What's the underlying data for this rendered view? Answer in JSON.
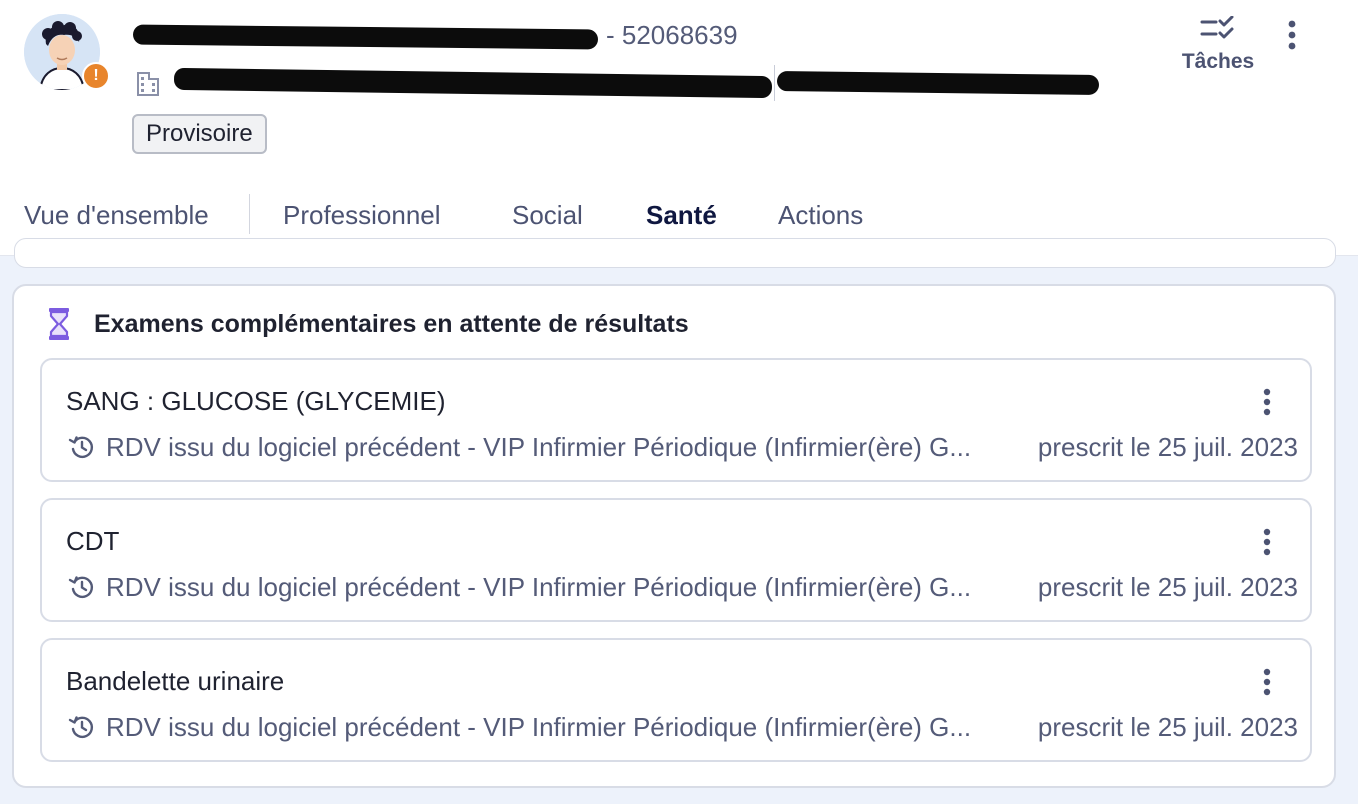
{
  "patient": {
    "id_suffix": "- 52068639",
    "status_badge": "Provisoire",
    "avatar_icon": "avatar-icon",
    "alert_icon": "alert-icon",
    "alert_symbol": "!",
    "alert_color": "#e8852c"
  },
  "company": {
    "icon": "building-icon"
  },
  "header_actions": {
    "tasks_label": "Tâches",
    "tasks_icon": "tasks-checklist-icon",
    "more_icon": "more-vertical-icon"
  },
  "tabs": [
    {
      "label": "Vue d'ensemble",
      "active": false
    },
    {
      "label": "Professionnel",
      "active": false
    },
    {
      "label": "Social",
      "active": false
    },
    {
      "label": "Santé",
      "active": true
    },
    {
      "label": "Actions",
      "active": false
    }
  ],
  "pending_exams": {
    "title": "Examens complémentaires en attente de résultats",
    "title_icon": "hourglass-icon",
    "items": [
      {
        "name": "SANG : GLUCOSE (GLYCEMIE)",
        "origin": "RDV issu du logiciel précédent - VIP Infirmier Périodique (Infirmier(ère) G...",
        "prescribed": "prescrit le 25 juil. 2023"
      },
      {
        "name": "CDT",
        "origin": "RDV issu du logiciel précédent - VIP Infirmier Périodique (Infirmier(ère) G...",
        "prescribed": "prescrit le 25 juil. 2023"
      },
      {
        "name": "Bandelette urinaire",
        "origin": "RDV issu du logiciel précédent - VIP Infirmier Périodique (Infirmier(ère) G...",
        "prescribed": "prescrit le 25 juil. 2023"
      }
    ]
  },
  "colors": {
    "accent": "#2f57d6",
    "content_background": "#edf2fb",
    "hourglass": "#7c5ce0"
  }
}
